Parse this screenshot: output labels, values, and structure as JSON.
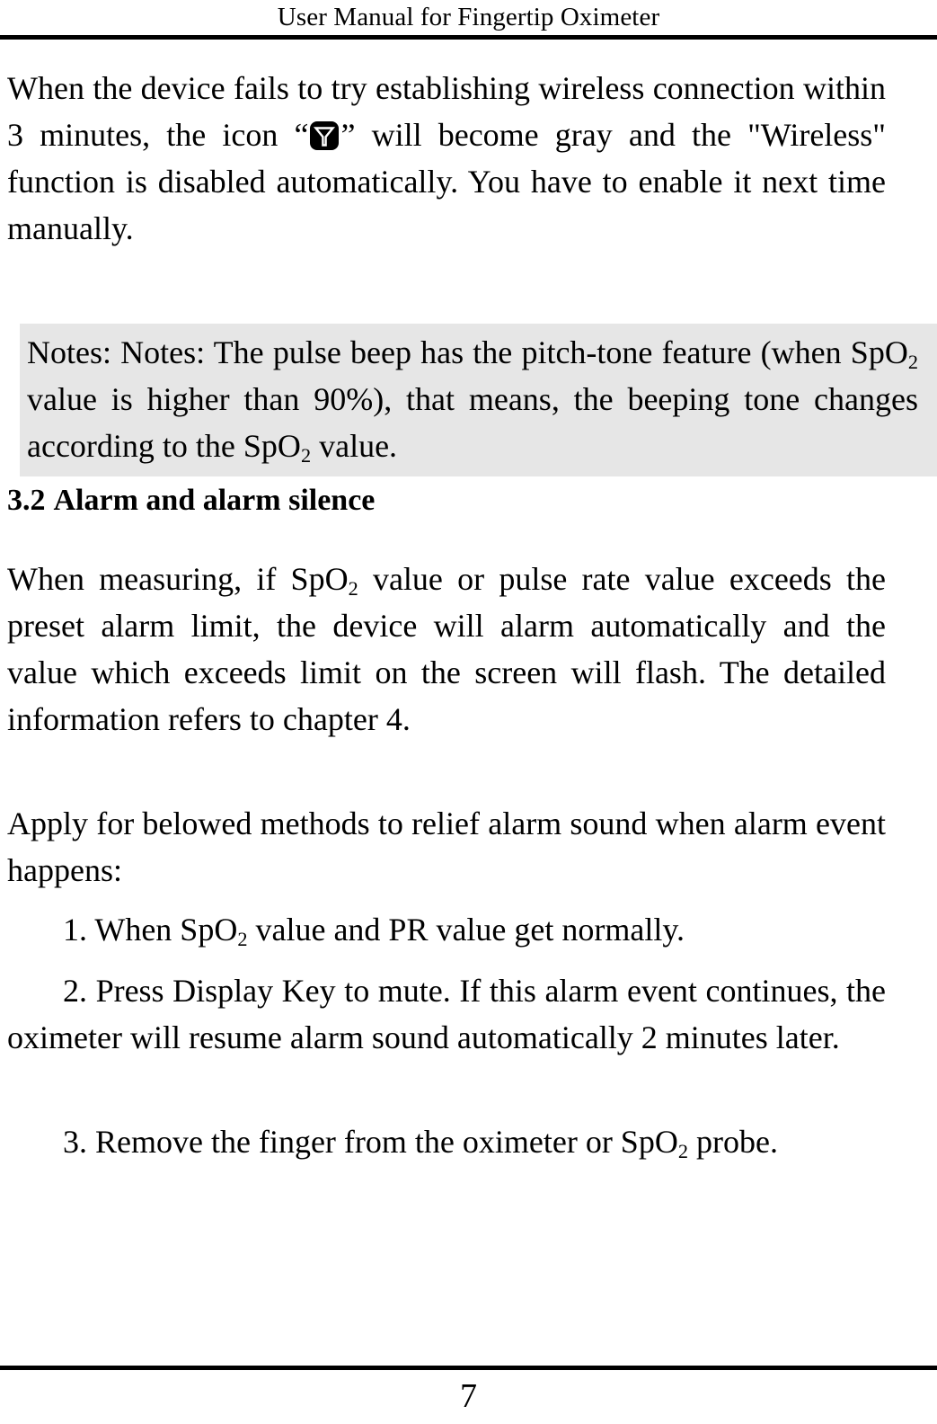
{
  "header": {
    "title": "User Manual for Fingertip Oximeter"
  },
  "body": {
    "paragraph_1_before_icon": "When the device fails to try establishing wireless connection within 3 minutes, the icon “",
    "icon_name": "wireless-antenna-icon",
    "paragraph_1_after_icon": "” will become gray and the \"Wireless\" function is disabled automatically. You have to enable it next time manually.",
    "notes": {
      "text_part_1": "Notes: Notes: The pulse beep has the pitch-tone feature (when SpO",
      "sub_1": "2",
      "text_part_2": " value is higher than 90%), that means, the beeping tone changes according to the SpO",
      "sub_2": "2",
      "text_part_3": " value.",
      "background_color": "#e6e6e6"
    },
    "heading": {
      "number": "3.2",
      "text": "Alarm and alarm silence"
    },
    "paragraph_2_part_1": "When measuring, if SpO",
    "paragraph_2_sub": "2",
    "paragraph_2_part_2": " value or pulse rate value exceeds the preset alarm limit, the device will alarm automatically and the value which exceeds limit on the screen will flash. The detailed information refers to chapter 4.",
    "paragraph_3": "Apply for belowed methods to relief alarm sound when alarm event happens:",
    "list": [
      {
        "part_1": "1. When  SpO",
        "sub": "2",
        "part_2": " value and PR value get normally."
      },
      {
        "part_1": "2. Press Display Key to mute. If this alarm event continues, the oximeter will resume alarm sound automatically 2 minutes later.",
        "sub": "",
        "part_2": ""
      },
      {
        "part_1": "3. Remove the finger from the oximeter or SpO",
        "sub": "2",
        "part_2": " probe."
      }
    ]
  },
  "footer": {
    "page_number": "7"
  }
}
